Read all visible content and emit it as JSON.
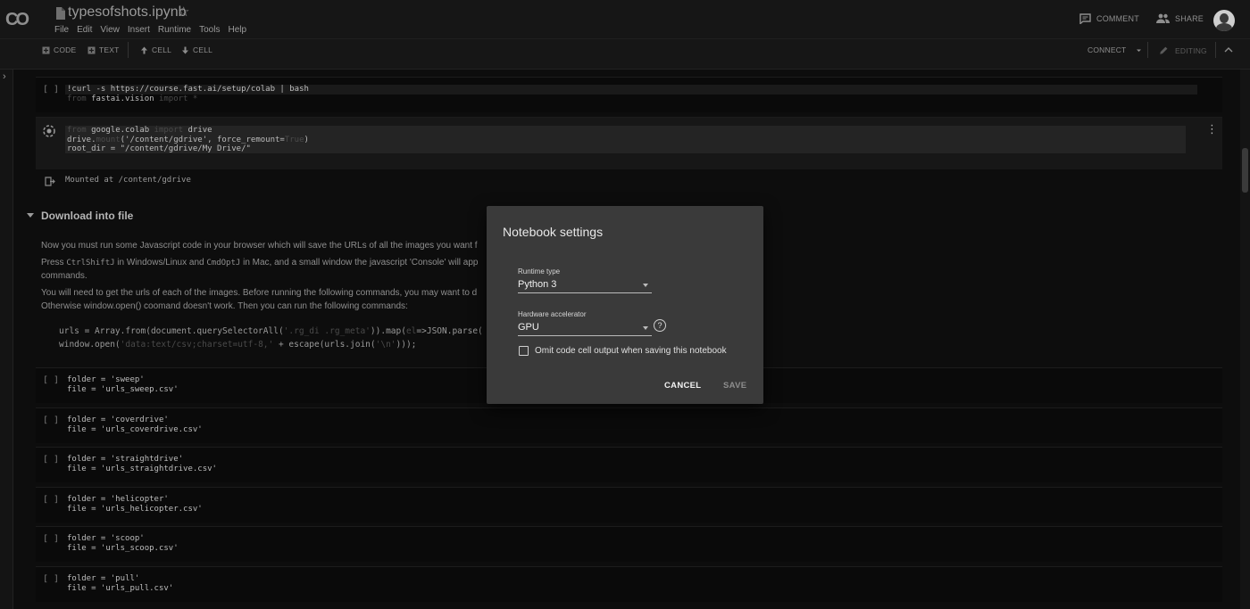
{
  "app": {
    "logo": "CO",
    "doc_title": "typesofshots.ipynb",
    "menu": [
      "File",
      "Edit",
      "View",
      "Insert",
      "Runtime",
      "Tools",
      "Help"
    ],
    "comment_label": "COMMENT",
    "share_label": "SHARE"
  },
  "toolbar": {
    "code_label": "CODE",
    "text_label": "TEXT",
    "cell_up_label": "CELL",
    "cell_down_label": "CELL",
    "connect_label": "CONNECT",
    "editing_label": "EDITING"
  },
  "cells": {
    "c1": {
      "bracket": "[ ]",
      "line1": "!curl -s https://course.fast.ai/setup/colab | bash",
      "line2_kw": "from",
      "line2_mod": " fastai.vision ",
      "line2_tail": "import *"
    },
    "c2": {
      "line1_kw": "from",
      "line1_mod": " google.colab ",
      "line1_kw2": "import",
      "line1_tail": " drive",
      "line2_a": "drive.",
      "line2_b": "mount",
      "line2_c": "('/content/gdrive', force_remount=",
      "line2_d": "True",
      "line2_e": ")",
      "line3": "root_dir = \"/content/gdrive/My Drive/\"",
      "output": "Mounted at /content/gdrive"
    },
    "c3": {
      "bracket": "[ ]",
      "line1": "folder = 'sweep'",
      "line2": "file = 'urls_sweep.csv'"
    },
    "c4": {
      "bracket": "[ ]",
      "line1": "folder = 'coverdrive'",
      "line2": "file = 'urls_coverdrive.csv'"
    },
    "c5": {
      "bracket": "[ ]",
      "line1": "folder = 'straightdrive'",
      "line2": "file = 'urls_straightdrive.csv'"
    },
    "c6": {
      "bracket": "[ ]",
      "line1": "folder = 'helicopter'",
      "line2": "file = 'urls_helicopter.csv'"
    },
    "c7": {
      "bracket": "[ ]",
      "line1": "folder = 'scoop'",
      "line2": "file = 'urls_scoop.csv'"
    },
    "c8": {
      "bracket": "[ ]",
      "line1": "folder = 'pull'",
      "line2": "file = 'urls_pull.csv'"
    }
  },
  "section": {
    "heading": "Download into file",
    "p1": "Now you must run some Javascript code in your browser which will save the URLs of all the images you want f",
    "p2a": "Press ",
    "p2b": "CtrlShiftJ",
    "p2c": " in Windows/Linux and ",
    "p2d": "CmdOptJ",
    "p2e": " in Mac, and a small window the javascript 'Console' will app",
    "p3": "commands.",
    "p4": "You will need to get the urls of each of the images. Before running the following commands, you may want to d",
    "p5": "Otherwise window.open() coomand doesn't work. Then you can run the following commands:",
    "js1a": "urls = Array.from(document.querySelectorAll(",
    "js1b": "'.rg_di .rg_meta'",
    "js1c": ")).map(",
    "js1d": "el",
    "js1e": "=>JSON.parse(",
    "js2a": "window.open(",
    "js2b": "'data:text/csv;charset=utf-8,'",
    "js2c": " + escape(urls.join(",
    "js2d": "'\\n'",
    "js2e": ")));"
  },
  "dialog": {
    "title": "Notebook settings",
    "runtime_label": "Runtime type",
    "runtime_value": "Python 3",
    "accel_label": "Hardware accelerator",
    "accel_value": "GPU",
    "help": "?",
    "omit_label": "Omit code cell output when saving this notebook",
    "omit_checked": false,
    "cancel": "CANCEL",
    "save": "SAVE"
  }
}
